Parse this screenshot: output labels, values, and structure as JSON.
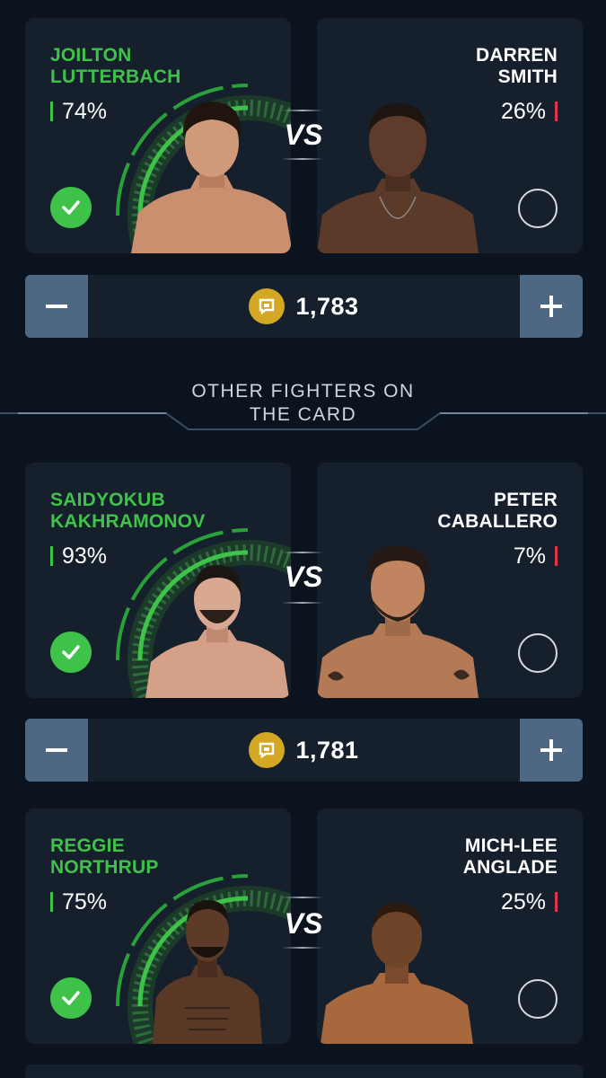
{
  "vs_label": "VS",
  "section": {
    "title": "OTHER FIGHTERS ON\nTHE CARD"
  },
  "fights": [
    {
      "left": {
        "name": "JOILTON\nLUTTERBACH",
        "pct": "74%",
        "selected": true
      },
      "right": {
        "name": "DARREN\nSMITH",
        "pct": "26%",
        "selected": false
      },
      "amount": "1,783"
    },
    {
      "left": {
        "name": "SAIDYOKUB\nKAKHRAMONOV",
        "pct": "93%",
        "selected": true
      },
      "right": {
        "name": "PETER\nCABALLERO",
        "pct": "7%",
        "selected": false
      },
      "amount": "1,781"
    },
    {
      "left": {
        "name": "REGGIE\nNORTHRUP",
        "pct": "75%",
        "selected": true
      },
      "right": {
        "name": "MICH-LEE\nANGLADE",
        "pct": "25%",
        "selected": false
      }
    }
  ],
  "colors": {
    "background": "#0b131f",
    "card": "#16202d",
    "accent_green": "#3fc249",
    "accent_red": "#e0344a",
    "stepper_button": "#4e6783",
    "coin": "#d5a823"
  },
  "icons": [
    "check-icon",
    "radio-icon",
    "minus-icon",
    "plus-icon",
    "coin-icon"
  ]
}
